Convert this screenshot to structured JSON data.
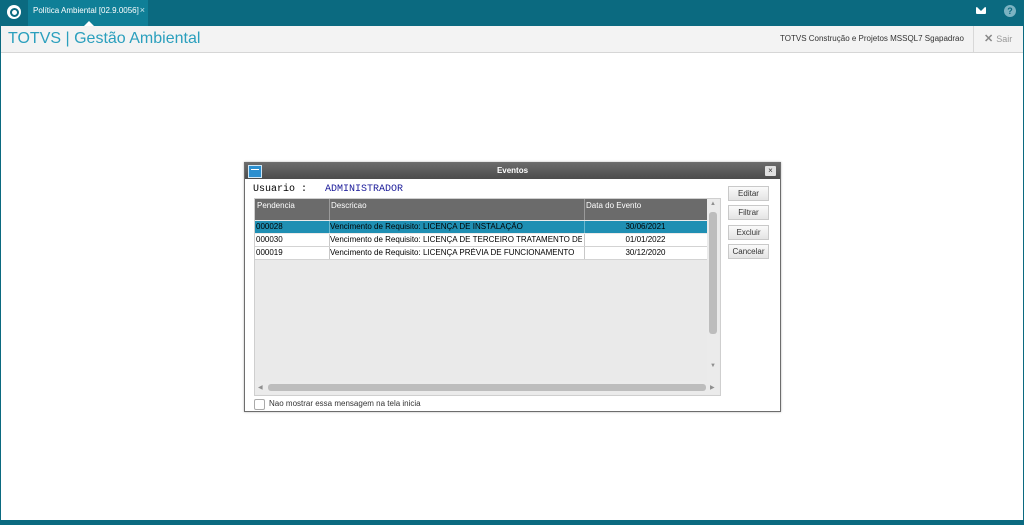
{
  "app": {
    "tab_label": "Política Ambiental [02.9.0056]",
    "tab_close": "×",
    "brand": "TOTVS | Gestão Ambiental",
    "company": "TOTVS Construção e Projetos MSSQL7 Sgapadrao",
    "exit_label": "Sair",
    "exit_icon": "✕",
    "help_icon": "?"
  },
  "dialog": {
    "title": "Eventos",
    "close_icon": "×",
    "user_label": "Usuario :",
    "user_value": "ADMINISTRADOR",
    "columns": [
      "Pendencia",
      "Descricao",
      "Data do Evento"
    ],
    "rows": [
      {
        "pendencia": "000028",
        "descricao": "Vencimento de Requisito: LICENÇA DE INSTALAÇÃO",
        "data": "30/06/2021",
        "selected": true
      },
      {
        "pendencia": "000030",
        "descricao": "Vencimento de Requisito: LICENÇA DE TERCEIRO TRATAMENTO DE RE",
        "data": "01/01/2022",
        "selected": false
      },
      {
        "pendencia": "000019",
        "descricao": "Vencimento de Requisito: LICENÇA PRÉVIA DE FUNCIONAMENTO",
        "data": "30/12/2020",
        "selected": false
      }
    ],
    "buttons": [
      "Editar",
      "Filtrar",
      "Excluir",
      "Cancelar"
    ],
    "checkbox_label": "Nao mostrar essa mensagem na tela inicia",
    "checkbox_checked": false
  },
  "colors": {
    "topbar": "#0b6a80",
    "brand": "#2a9fbd",
    "selected_row": "#1f8fb3",
    "header_grid": "#6b6b6b"
  }
}
